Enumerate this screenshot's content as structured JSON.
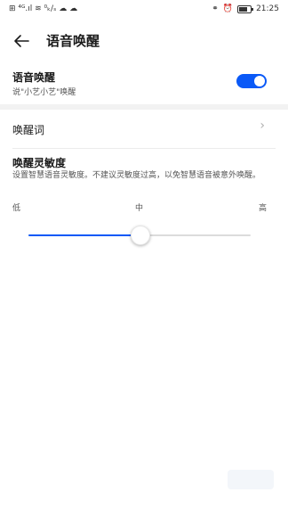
{
  "status_bar": {
    "left_icons": [
      "sim-icon",
      "signal-icon",
      "wifi-icon",
      "speed-icon",
      "wechat-icon",
      "wechat2-icon"
    ],
    "left_text": "⊞ ⁴ᴳ.ıl ≋ ⁰ₖ/ₛ ☁ ☁",
    "bluetooth_glyph": "⚭",
    "alarm_glyph": "⏰",
    "battery_level": 0.75,
    "time": "21:25"
  },
  "header": {
    "back_glyph": "←",
    "title": "语音唤醒"
  },
  "voice_wakeup": {
    "title": "语音唤醒",
    "subtitle": "说\"小艺小艺\"唤醒",
    "toggle_on": true
  },
  "wake_word": {
    "title": "唤醒词",
    "chevron": "›"
  },
  "sensitivity": {
    "title": "唤醒灵敏度",
    "description": "设置智慧语音灵敏度。不建议灵敏度过高，以免智慧语音被意外唤醒。",
    "labels": {
      "low": "低",
      "mid": "中",
      "high": "高"
    },
    "value": 0.5
  },
  "colors": {
    "accent": "#0a59f7",
    "track": "#dcdcdc",
    "text_primary": "#1a1a1a",
    "text_secondary": "#555555"
  }
}
